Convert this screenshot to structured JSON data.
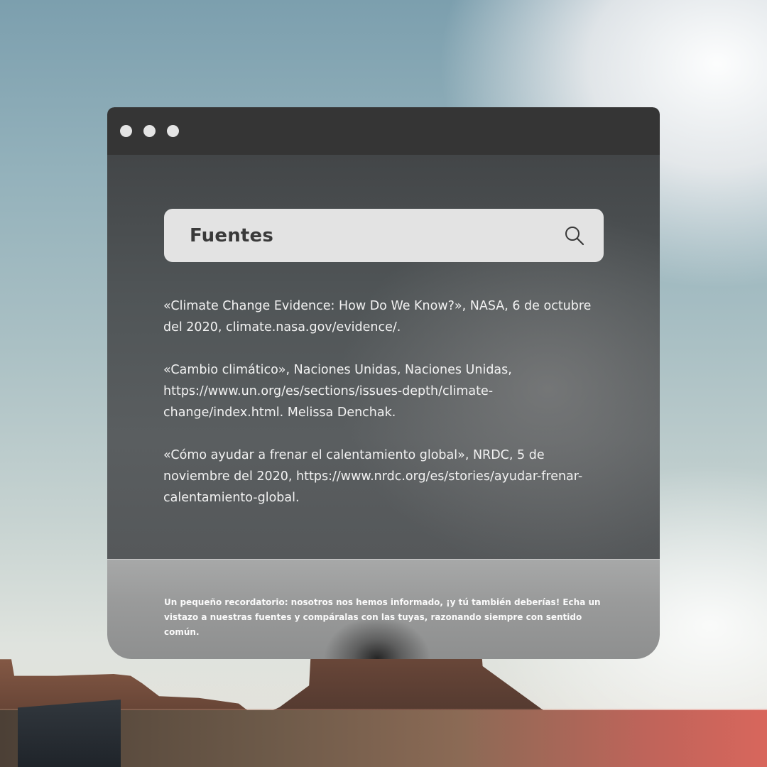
{
  "search": {
    "query": "Fuentes",
    "icon": "search-icon"
  },
  "sources": [
    {
      "text": "«Climate Change Evidence: How Do We Know?», NASA, 6 de octubre del 2020, climate.nasa.gov/evidence/."
    },
    {
      "text": "«Cambio climático», Naciones Unidas, Naciones Unidas, https://www.un.org/es/sections/issues-depth/climate-change/index.html. Melissa Denchak."
    },
    {
      "text": "«Cómo ayudar a frenar el calentamiento global», NRDC, 5 de noviembre del 2020, https://www.nrdc.org/es/stories/ayudar-frenar-calentamiento-global."
    }
  ],
  "reminder": "Un pequeño recordatorio: nosotros nos hemos informado, ¡y tú también deberías! Echa un vistazo a nuestras fuentes y compáralas con las tuyas, razonando siempre con sentido común.",
  "colors": {
    "titlebar": "#353535",
    "window_dot": "#e4e4e4",
    "search_bg": "#e3e3e3",
    "panel": "#505557",
    "footer": "#9a9b9b"
  }
}
